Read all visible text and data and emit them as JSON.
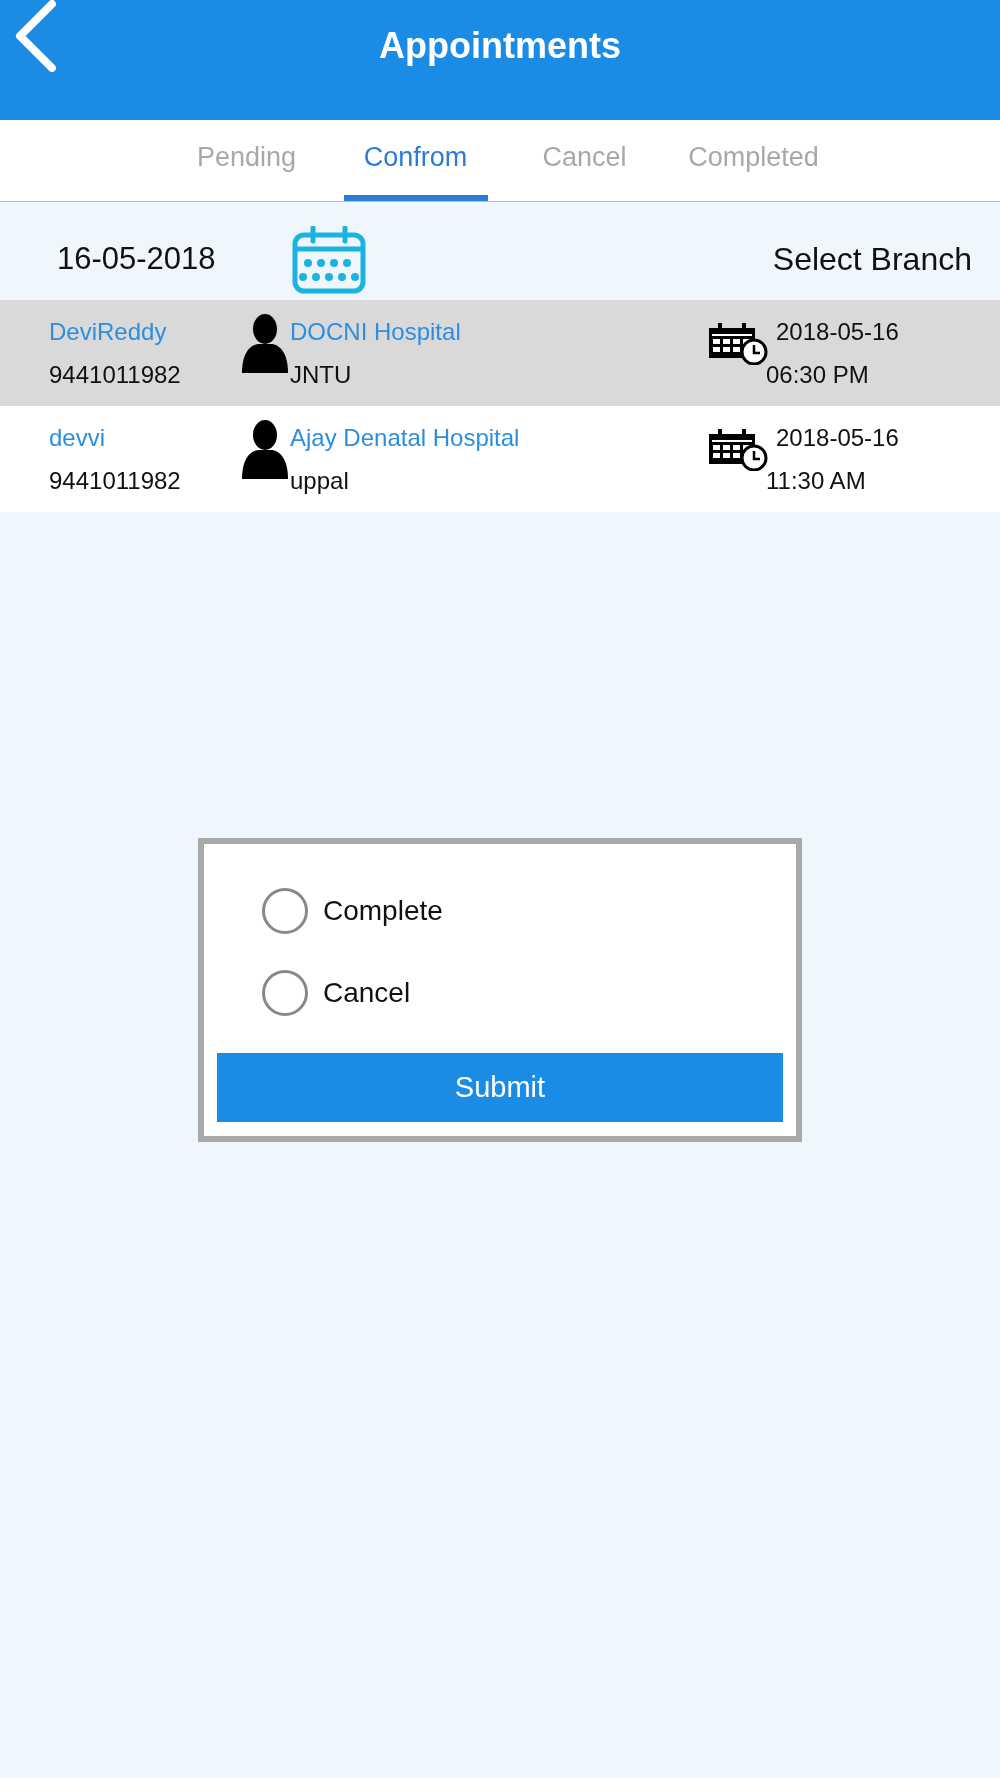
{
  "header": {
    "title": "Appointments"
  },
  "tabs": [
    {
      "label": "Pending",
      "selected": false
    },
    {
      "label": "Confrom",
      "selected": true
    },
    {
      "label": "Cancel",
      "selected": false
    },
    {
      "label": "Completed",
      "selected": false
    }
  ],
  "filter": {
    "date": "16-05-2018",
    "branch": "Select Branch"
  },
  "appointments": [
    {
      "patient": "DeviReddy",
      "phone": "9441011982",
      "hospital": "DOCNI Hospital",
      "location": "JNTU",
      "date": "2018-05-16",
      "time": "06:30 PM",
      "selected": true
    },
    {
      "patient": "devvi",
      "phone": "9441011982",
      "hospital": "Ajay Denatal Hospital",
      "location": "uppal",
      "date": "2018-05-16",
      "time": "11:30 AM",
      "selected": false
    }
  ],
  "dialog": {
    "options": [
      {
        "label": "Complete",
        "selected": false
      },
      {
        "label": "Cancel",
        "selected": false
      }
    ],
    "submit": "Submit"
  }
}
